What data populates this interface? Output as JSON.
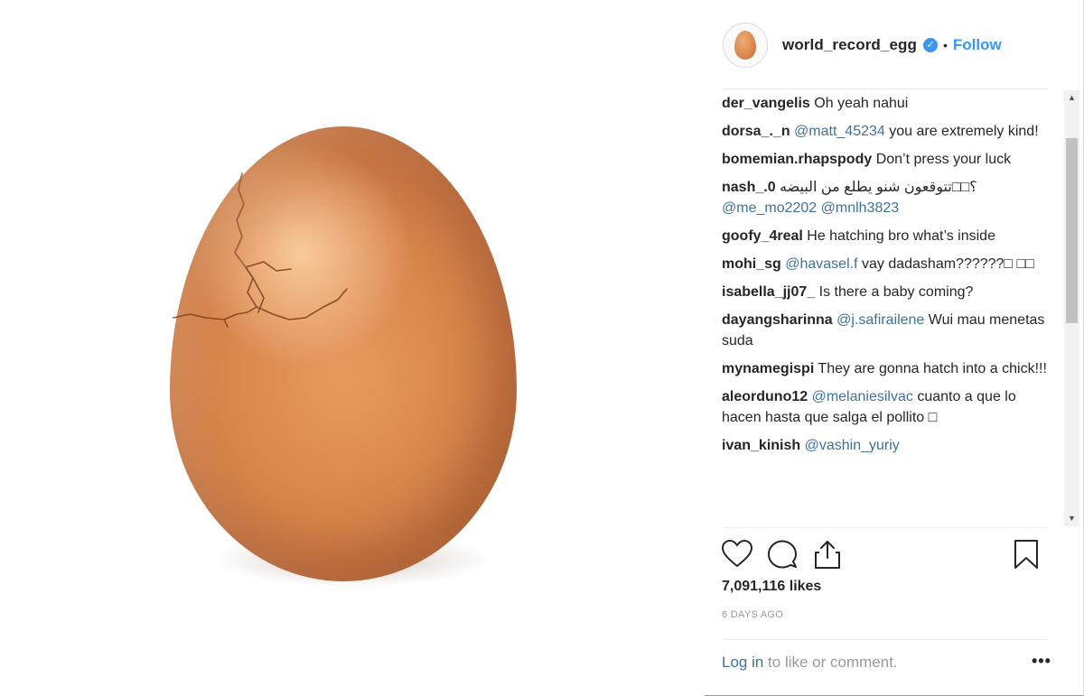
{
  "post": {
    "username": "world_record_egg",
    "verified_glyph": "✓",
    "separator": "•",
    "follow_label": "Follow",
    "likes": "7,091,116 likes",
    "time_ago": "6 DAYS AGO",
    "login_link": "Log in",
    "login_rest": " to like or comment.",
    "more_label": "•••"
  },
  "comments": [
    {
      "user": "der_vangelis",
      "mention": "",
      "text": " Oh yeah nahui"
    },
    {
      "user": "dorsa_._n",
      "mention": " @matt_45234",
      "text": " you are extremely kind!"
    },
    {
      "user": "bomemian.rhapspody",
      "mention": "",
      "text": " Don’t press your luck"
    },
    {
      "user": "nash_.0",
      "mention": "",
      "text": " ؟□□تتوقعون شنو يطلع من البيضه",
      "mention2": "@me_mo2202 @mnlh3823"
    },
    {
      "user": "goofy_4real",
      "mention": "",
      "text": " He hatching bro what’s inside"
    },
    {
      "user": "mohi_sg",
      "mention": " @havasel.f",
      "text": " vay dadasham??????□ □□"
    },
    {
      "user": "isabella_jj07_",
      "mention": "",
      "text": " Is there a baby coming?"
    },
    {
      "user": "dayangsharinna",
      "mention": " @j.safirailene",
      "text": " Wui mau menetas suda"
    },
    {
      "user": "mynamegispi",
      "mention": "",
      "text": " They are gonna hatch into a chick!!!"
    },
    {
      "user": "aleorduno12",
      "mention": " @melaniesilvac",
      "text": " cuanto a que lo hacen hasta que salga el pollito □"
    },
    {
      "user": "ivan_kinish",
      "mention": " @vashin_yuriy",
      "text": ""
    }
  ],
  "scrollbar": {
    "up": "▲",
    "down": "▼"
  },
  "icons": {
    "like": "heart-icon",
    "comment": "comment-bubble-icon",
    "share": "share-icon",
    "save": "bookmark-icon",
    "verified": "verified-badge-icon"
  },
  "colors": {
    "link_blue": "#3897f0",
    "mention_blue": "#3f729b",
    "text": "#262626",
    "muted": "#999999"
  }
}
